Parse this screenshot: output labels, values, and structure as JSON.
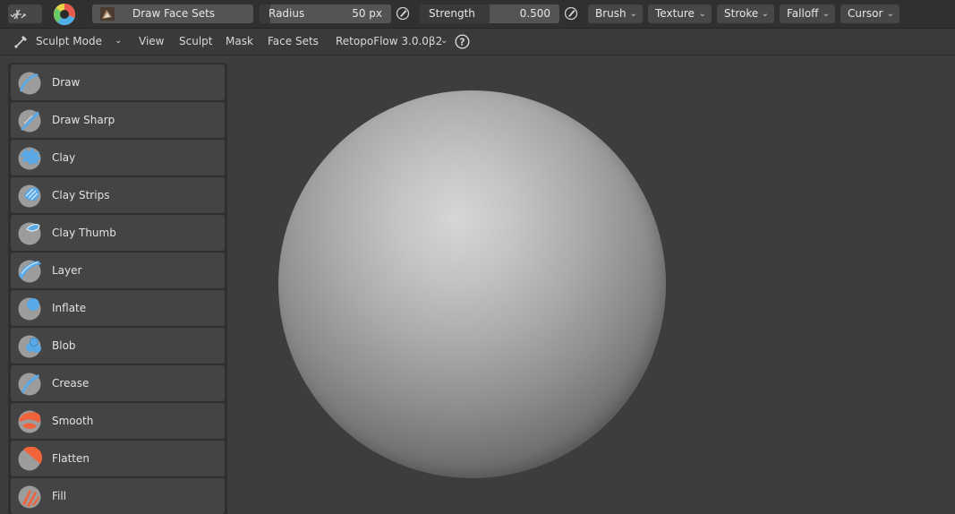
{
  "header": {
    "brush_name": "Draw Face Sets",
    "radius_label": "Radius",
    "radius_value": "50 px",
    "strength_label": "Strength",
    "strength_value": "0.500",
    "strength_fraction": 0.5,
    "menus": [
      "Brush",
      "Texture",
      "Stroke",
      "Falloff",
      "Cursor"
    ]
  },
  "menubar": {
    "mode": "Sculpt Mode",
    "items": [
      "View",
      "Sculpt",
      "Mask",
      "Face Sets"
    ],
    "addon": "RetopoFlow 3.0.0β2"
  },
  "tools": [
    {
      "label": "Draw",
      "icon": "draw-brush-icon"
    },
    {
      "label": "Draw Sharp",
      "icon": "draw-sharp-brush-icon"
    },
    {
      "label": "Clay",
      "icon": "clay-brush-icon"
    },
    {
      "label": "Clay Strips",
      "icon": "clay-strips-brush-icon"
    },
    {
      "label": "Clay Thumb",
      "icon": "clay-thumb-brush-icon"
    },
    {
      "label": "Layer",
      "icon": "layer-brush-icon"
    },
    {
      "label": "Inflate",
      "icon": "inflate-brush-icon"
    },
    {
      "label": "Blob",
      "icon": "blob-brush-icon"
    },
    {
      "label": "Crease",
      "icon": "crease-brush-icon"
    },
    {
      "label": "Smooth",
      "icon": "smooth-brush-icon"
    },
    {
      "label": "Flatten",
      "icon": "flatten-brush-icon"
    },
    {
      "label": "Fill",
      "icon": "fill-brush-icon"
    }
  ],
  "colors": {
    "add_blue": "#5aa9e6",
    "subtract_orange": "#f0643c",
    "brush_gray": "#9c9c9c"
  }
}
